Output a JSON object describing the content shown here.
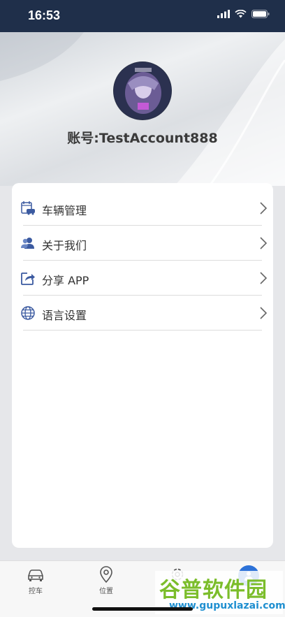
{
  "status_bar": {
    "time": "16:53"
  },
  "profile": {
    "account_text": "账号:TestAccount888"
  },
  "menu": {
    "items": [
      {
        "label": "车辆管理",
        "icon": "vehicle-calendar-icon"
      },
      {
        "label": "关于我们",
        "icon": "users-icon"
      },
      {
        "label": "分享 APP",
        "icon": "share-icon"
      },
      {
        "label": "语言设置",
        "icon": "globe-icon"
      }
    ]
  },
  "tabbar": {
    "tabs": [
      {
        "label": "控车",
        "icon": "car-icon"
      },
      {
        "label": "位置",
        "icon": "location-pin-icon"
      },
      {
        "label": "",
        "icon": "settings-gear-icon"
      },
      {
        "label": "",
        "icon": "profile-icon",
        "active": true
      }
    ]
  },
  "watermark": {
    "title": "谷普软件园",
    "url": "www.gupuxlazai.com"
  },
  "colors": {
    "accent": "#2d72d8",
    "status_bar": "#1f2f4a",
    "icon_blue": "#3b5aa0"
  }
}
